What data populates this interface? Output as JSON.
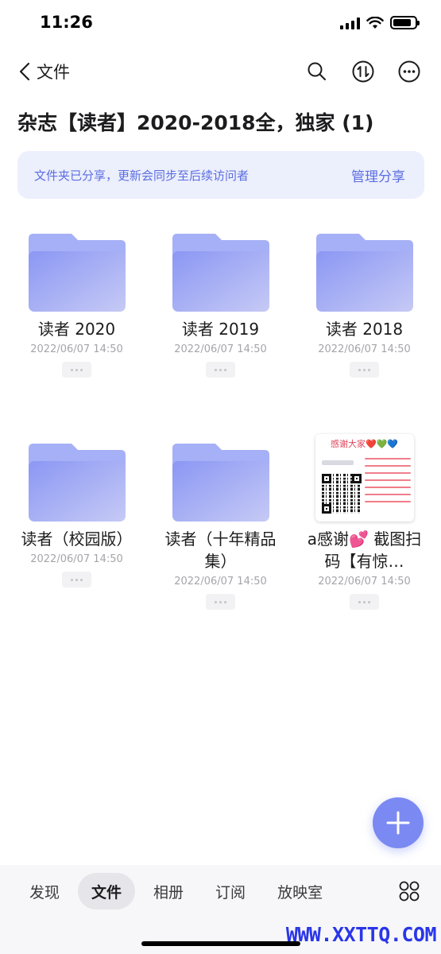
{
  "status_bar": {
    "time": "11:26",
    "battery_level": 0.85
  },
  "nav": {
    "back_label": "文件",
    "icons": [
      "chevron-left-icon",
      "search-icon",
      "sort-icon",
      "more-icon"
    ]
  },
  "page_title": "杂志【读者】2020-2018全，独家 (1)",
  "share_banner": {
    "text": "文件夹已分享，更新会同步至后续访问者",
    "action": "管理分享"
  },
  "items": [
    {
      "type": "folder",
      "name": "读者 2020",
      "date": "2022/06/07 14:50"
    },
    {
      "type": "folder",
      "name": "读者 2019",
      "date": "2022/06/07 14:50"
    },
    {
      "type": "folder",
      "name": "读者 2018",
      "date": "2022/06/07 14:50"
    },
    {
      "type": "folder",
      "name": "读者（校园版）",
      "date": "2022/06/07 14:50"
    },
    {
      "type": "folder",
      "name": "读者（十年精品集）",
      "date": "2022/06/07 14:50"
    },
    {
      "type": "image",
      "name": "a感谢💕 截图扫码【有惊…",
      "date": "2022/06/07 14:50",
      "thumb_title": "感谢大家",
      "thumb_hearts": "❤️💚💙"
    }
  ],
  "tabs": [
    {
      "label": "发现",
      "active": false
    },
    {
      "label": "文件",
      "active": true
    },
    {
      "label": "相册",
      "active": false
    },
    {
      "label": "订阅",
      "active": false
    },
    {
      "label": "放映室",
      "active": false
    }
  ],
  "colors": {
    "accent": "#5b6ee1",
    "folder_top": "#a6b0f6",
    "folder_front": "#8b97f4",
    "fab": "#7b89f2"
  },
  "watermark": "WWW.XXTTQ.COM"
}
